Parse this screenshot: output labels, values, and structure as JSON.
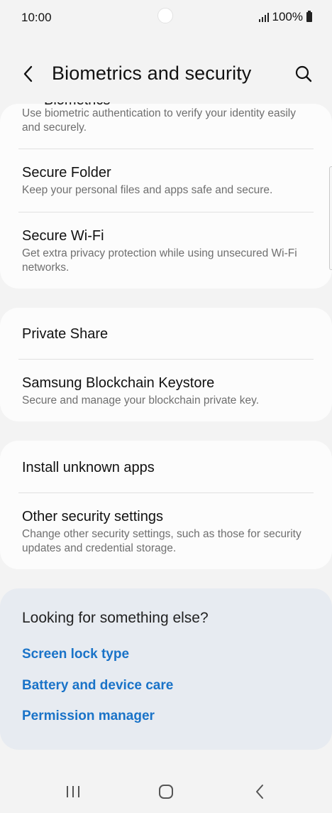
{
  "status_bar": {
    "time": "10:00",
    "battery": "100%"
  },
  "header": {
    "title": "Biometrics and security",
    "back_icon": "chevron-left-icon",
    "search_icon": "search-icon"
  },
  "card1": {
    "partial_item": {
      "title": "Biometrics",
      "subtitle": "Use biometric authentication to verify your identity easily and securely."
    },
    "items": [
      {
        "title": "Secure Folder",
        "subtitle": "Keep your personal files and apps safe and secure."
      },
      {
        "title": "Secure Wi-Fi",
        "subtitle": "Get extra privacy protection while using unsecured Wi-Fi networks."
      }
    ]
  },
  "card2": {
    "items": [
      {
        "title": "Private Share"
      },
      {
        "title": "Samsung Blockchain Keystore",
        "subtitle": "Secure and manage your blockchain private key."
      }
    ]
  },
  "card3": {
    "items": [
      {
        "title": "Install unknown apps"
      },
      {
        "title": "Other security settings",
        "subtitle": "Change other security settings, such as those for security updates and credential storage."
      }
    ]
  },
  "suggestions": {
    "title": "Looking for something else?",
    "links": [
      "Screen lock type",
      "Battery and device care",
      "Permission manager"
    ]
  },
  "colors": {
    "accent": "#1a73c8",
    "background": "#f3f3f3",
    "card": "#fcfcfc",
    "suggest_card": "#e7ebf1"
  }
}
